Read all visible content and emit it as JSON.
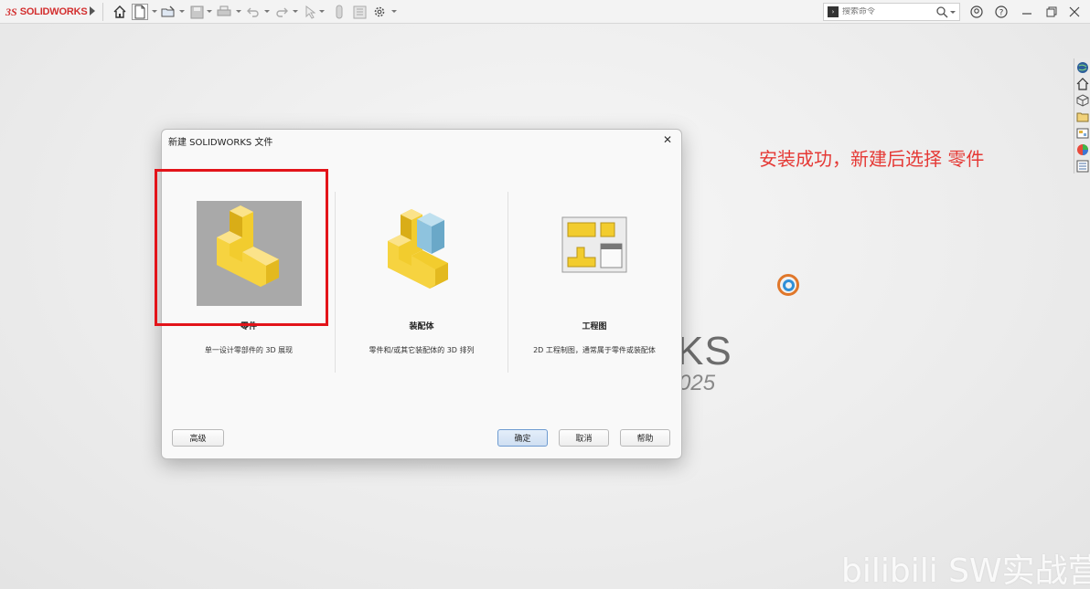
{
  "app": {
    "logo_prefix": "3S",
    "logo_name": "SOLIDWORKS",
    "brand_bg_text": "KS",
    "brand_bg_year": "025"
  },
  "search": {
    "placeholder": "搜索命令"
  },
  "annotation": "安装成功，新建后选择 零件",
  "watermark": "bilibili SW实战营",
  "dialog": {
    "title": "新建 SOLIDWORKS 文件",
    "close_label": "✕",
    "options": [
      {
        "label": "零件",
        "description": "单一设计零部件的 3D 展现"
      },
      {
        "label": "装配体",
        "description": "零件和/或其它装配体的 3D 排列"
      },
      {
        "label": "工程图",
        "description": "2D 工程制图，通常属于零件或装配体"
      }
    ],
    "buttons": {
      "advanced": "高级",
      "ok": "确定",
      "cancel": "取消",
      "help": "帮助"
    }
  },
  "colors": {
    "accent_red": "#e3141a",
    "annotation_red": "#e53935",
    "part_yellow": "#f2cc2e",
    "assembly_blue": "#8ec3de"
  },
  "icons": {
    "toolbar": [
      "home-icon",
      "new-document-icon",
      "open-icon",
      "save-icon",
      "print-icon",
      "undo-icon",
      "redo-icon",
      "select-icon",
      "rebuild-icon",
      "file-properties-icon",
      "options-icon"
    ],
    "right_panel": [
      "globe-icon",
      "home-icon",
      "cube-icon",
      "folder-icon",
      "view-palette-icon",
      "appearance-icon",
      "custom-properties-icon"
    ]
  }
}
